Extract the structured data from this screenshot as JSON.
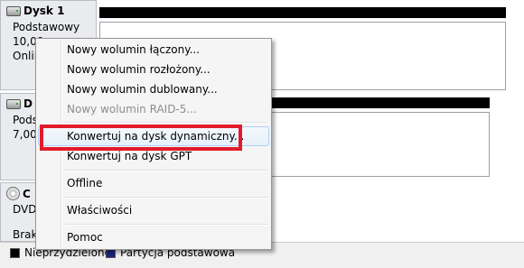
{
  "disks": [
    {
      "name": "Dysk 1",
      "type": "Podstawowy",
      "size": "10,00",
      "status": "Onlin"
    },
    {
      "name": "D",
      "type": "Podst",
      "size": "7,00",
      "status": ""
    },
    {
      "name": "C",
      "type": "DVD",
      "size": "",
      "status": "Brak"
    }
  ],
  "legend": [
    {
      "label": "Nieprzydzielone",
      "color": "#000000"
    },
    {
      "label": "Partycja podstawowa",
      "color": "#1a237e"
    }
  ],
  "context_menu": {
    "items": [
      {
        "label": "Nowy wolumin łączony...",
        "enabled": true
      },
      {
        "label": "Nowy wolumin rozłożony...",
        "enabled": true
      },
      {
        "label": "Nowy wolumin dublowany...",
        "enabled": true
      },
      {
        "label": "Nowy wolumin RAID-5...",
        "enabled": false
      },
      {
        "label": "Konwertuj na dysk dynamiczny...",
        "enabled": true,
        "hovered": true
      },
      {
        "label": "Konwertuj na dysk GPT",
        "enabled": true
      },
      {
        "label": "Offline",
        "enabled": true
      },
      {
        "label": "Właściwości",
        "enabled": true
      },
      {
        "label": "Pomoc",
        "enabled": true
      }
    ]
  },
  "colors": {
    "highlight_box": "#e21b2a",
    "unallocated": "#000000",
    "primary_partition": "#1a237e"
  }
}
